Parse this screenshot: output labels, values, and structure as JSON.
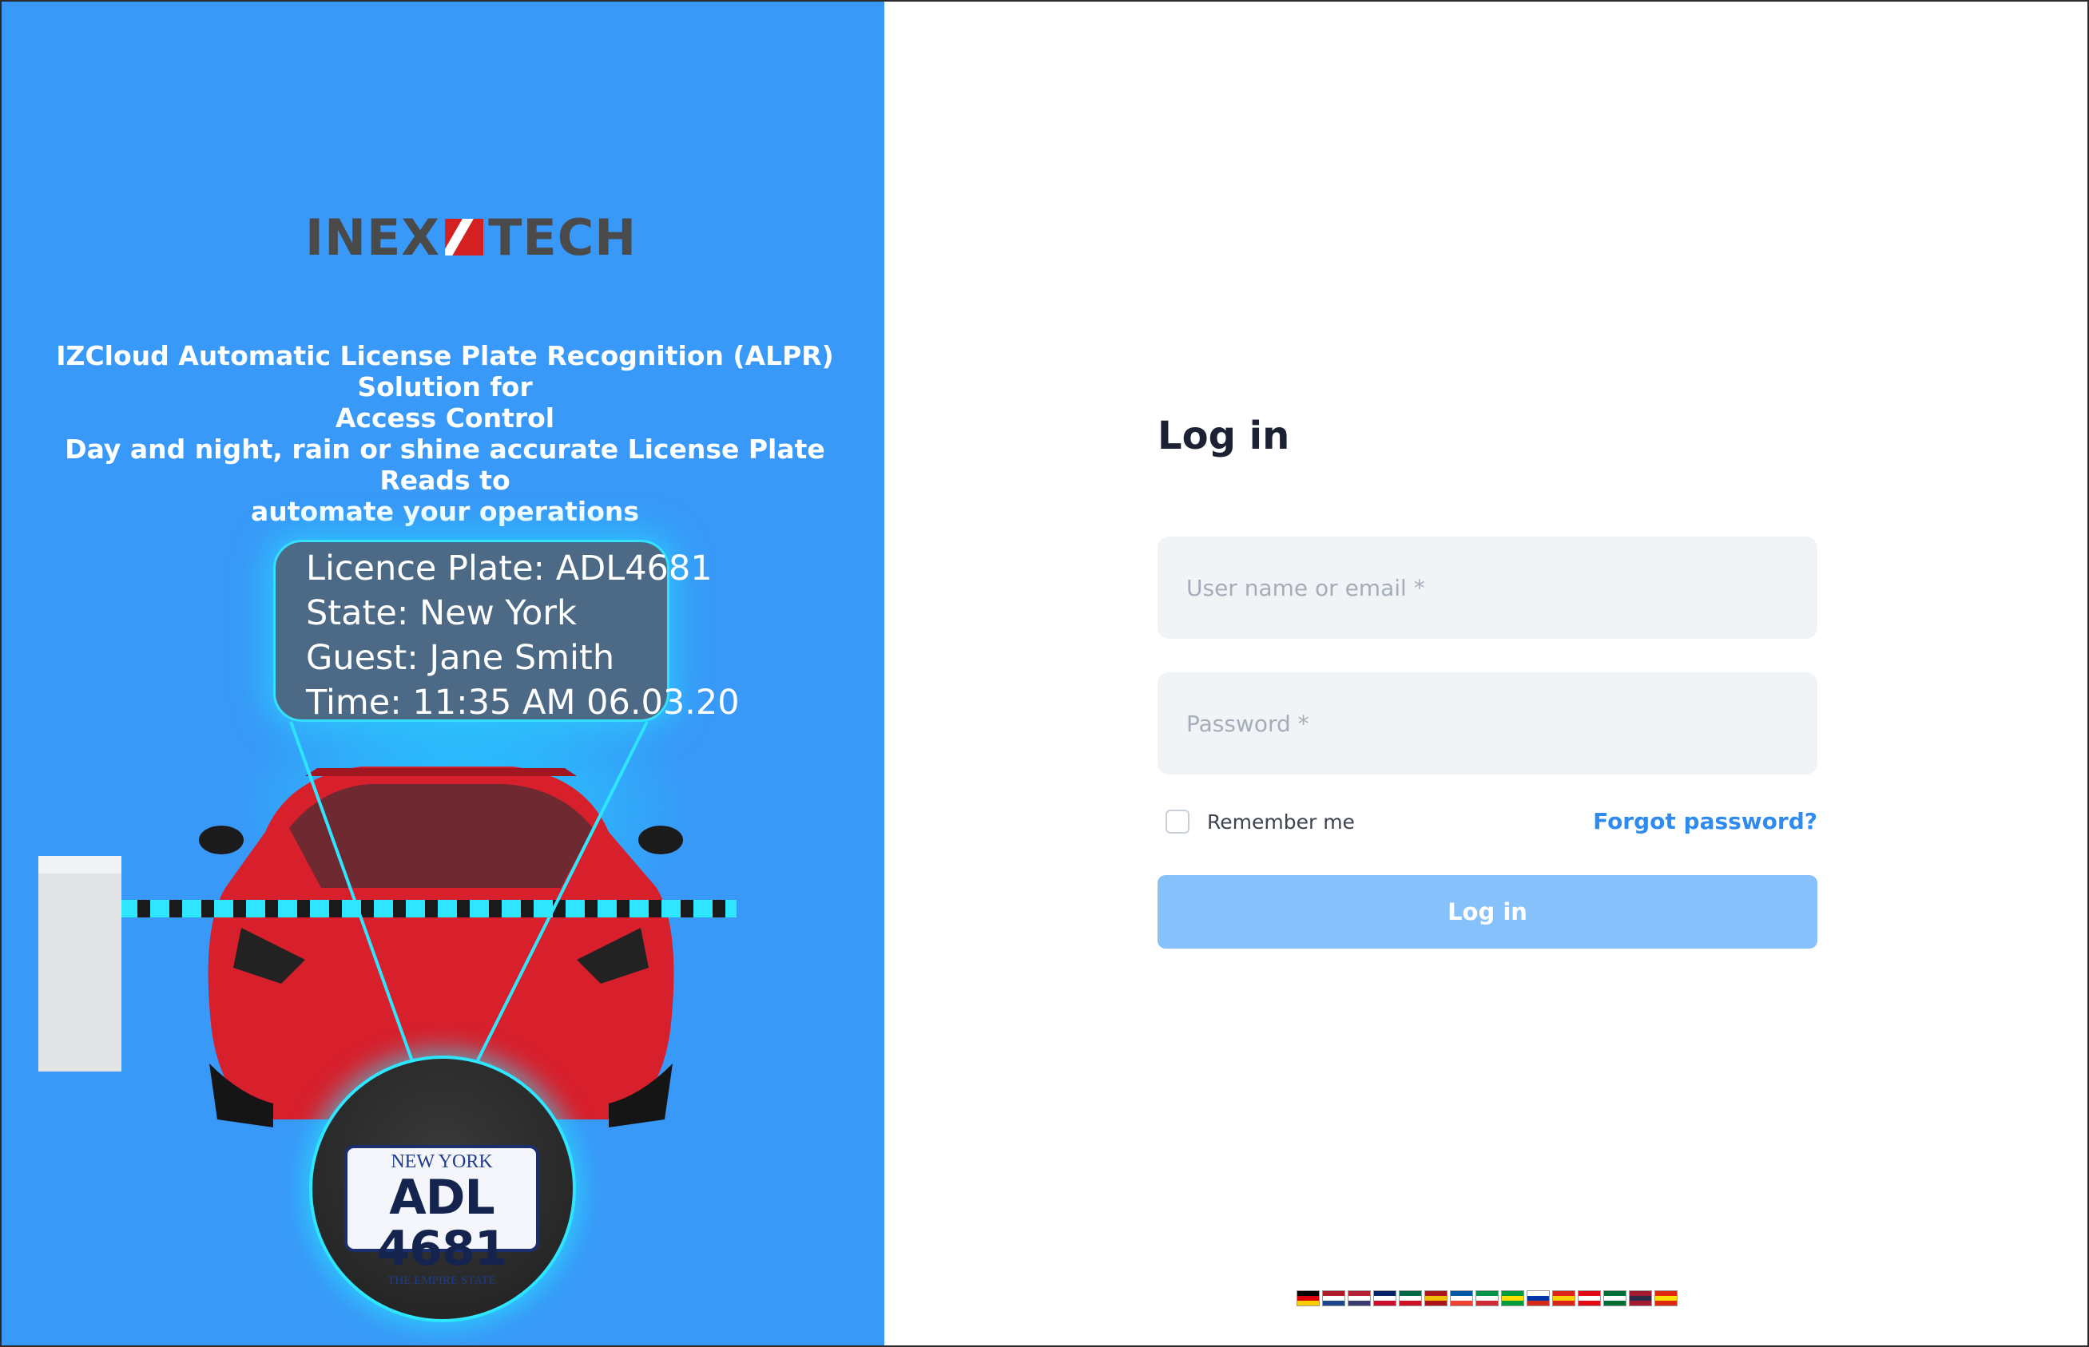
{
  "brand": {
    "logo_left": "INEX",
    "logo_right": "TECH",
    "tagline": [
      "IZCloud Automatic License Plate Recognition (ALPR) Solution for",
      "Access Control",
      "Day and night, rain or shine accurate License Plate Reads to",
      "automate your operations"
    ]
  },
  "recognition_bubble": {
    "line1": "Licence Plate: ADL4681",
    "line2": "State: New York",
    "line3": "Guest: Jane Smith",
    "line4": "Time: 11:35 AM 06.03.20"
  },
  "plate": {
    "state": "NEW YORK",
    "number": "ADL 4681",
    "motto": "THE EMPIRE STATE"
  },
  "login": {
    "title": "Log in",
    "username_placeholder": "User name or email *",
    "username_value": "",
    "password_placeholder": "Password *",
    "password_value": "",
    "remember_label": "Remember me",
    "remember_checked": false,
    "forgot_label": "Forgot password?",
    "submit_label": "Log in"
  },
  "colors": {
    "left_panel": "#3899f8",
    "button": "#86c1fb",
    "link": "#2f8bef",
    "input_bg": "#f1f4f7"
  },
  "languages": [
    {
      "name": "german-flag",
      "colors": [
        "#000000",
        "#dd0000",
        "#ffce00"
      ]
    },
    {
      "name": "dutch-flag",
      "colors": [
        "#ae1c28",
        "#ffffff",
        "#21468b"
      ]
    },
    {
      "name": "us-flag",
      "colors": [
        "#b22234",
        "#ffffff",
        "#3c3b6e"
      ]
    },
    {
      "name": "uk-flag",
      "colors": [
        "#012169",
        "#ffffff",
        "#c8102e"
      ]
    },
    {
      "name": "mexico-flag",
      "colors": [
        "#006847",
        "#ffffff",
        "#ce1126"
      ]
    },
    {
      "name": "spain-flag",
      "colors": [
        "#aa151b",
        "#f1bf00",
        "#aa151b"
      ]
    },
    {
      "name": "france-flag",
      "colors": [
        "#0055a4",
        "#ffffff",
        "#ef4135"
      ]
    },
    {
      "name": "italy-flag",
      "colors": [
        "#009246",
        "#ffffff",
        "#ce2b37"
      ]
    },
    {
      "name": "brazil-flag",
      "colors": [
        "#009c3b",
        "#ffdf00",
        "#009c3b"
      ]
    },
    {
      "name": "russia-flag",
      "colors": [
        "#ffffff",
        "#0039a6",
        "#d52b1e"
      ]
    },
    {
      "name": "vietnam-flag",
      "colors": [
        "#da251d",
        "#ffcd00",
        "#da251d"
      ]
    },
    {
      "name": "turkey-flag",
      "colors": [
        "#e30a17",
        "#ffffff",
        "#e30a17"
      ]
    },
    {
      "name": "saudi-flag",
      "colors": [
        "#006c35",
        "#ffffff",
        "#006c35"
      ]
    },
    {
      "name": "thailand-flag",
      "colors": [
        "#a51931",
        "#2d2a4a",
        "#a51931"
      ]
    },
    {
      "name": "china-flag",
      "colors": [
        "#de2910",
        "#ffde00",
        "#de2910"
      ]
    }
  ]
}
